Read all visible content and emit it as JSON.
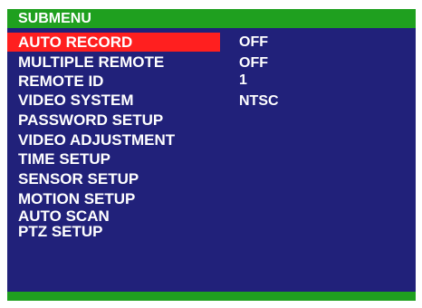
{
  "menu": {
    "title": "SUBMENU",
    "items": [
      {
        "label": "AUTO RECORD",
        "value": "OFF"
      },
      {
        "label": "MULTIPLE REMOTE",
        "value": "OFF"
      },
      {
        "label": "REMOTE ID",
        "value": "1"
      },
      {
        "label": "VIDEO SYSTEM",
        "value": "NTSC"
      },
      {
        "label": "PASSWORD SETUP"
      },
      {
        "label": "VIDEO ADJUSTMENT"
      },
      {
        "label": "TIME SETUP"
      },
      {
        "label": "SENSOR SETUP"
      },
      {
        "label": "MOTION SETUP"
      },
      {
        "label": "AUTO SCAN"
      },
      {
        "label": "PTZ SETUP"
      }
    ],
    "selected_index": 0
  },
  "colors": {
    "background": "#21217a",
    "bar": "#1fa01f",
    "highlight": "#ff1f1f",
    "text": "#ffffff"
  }
}
